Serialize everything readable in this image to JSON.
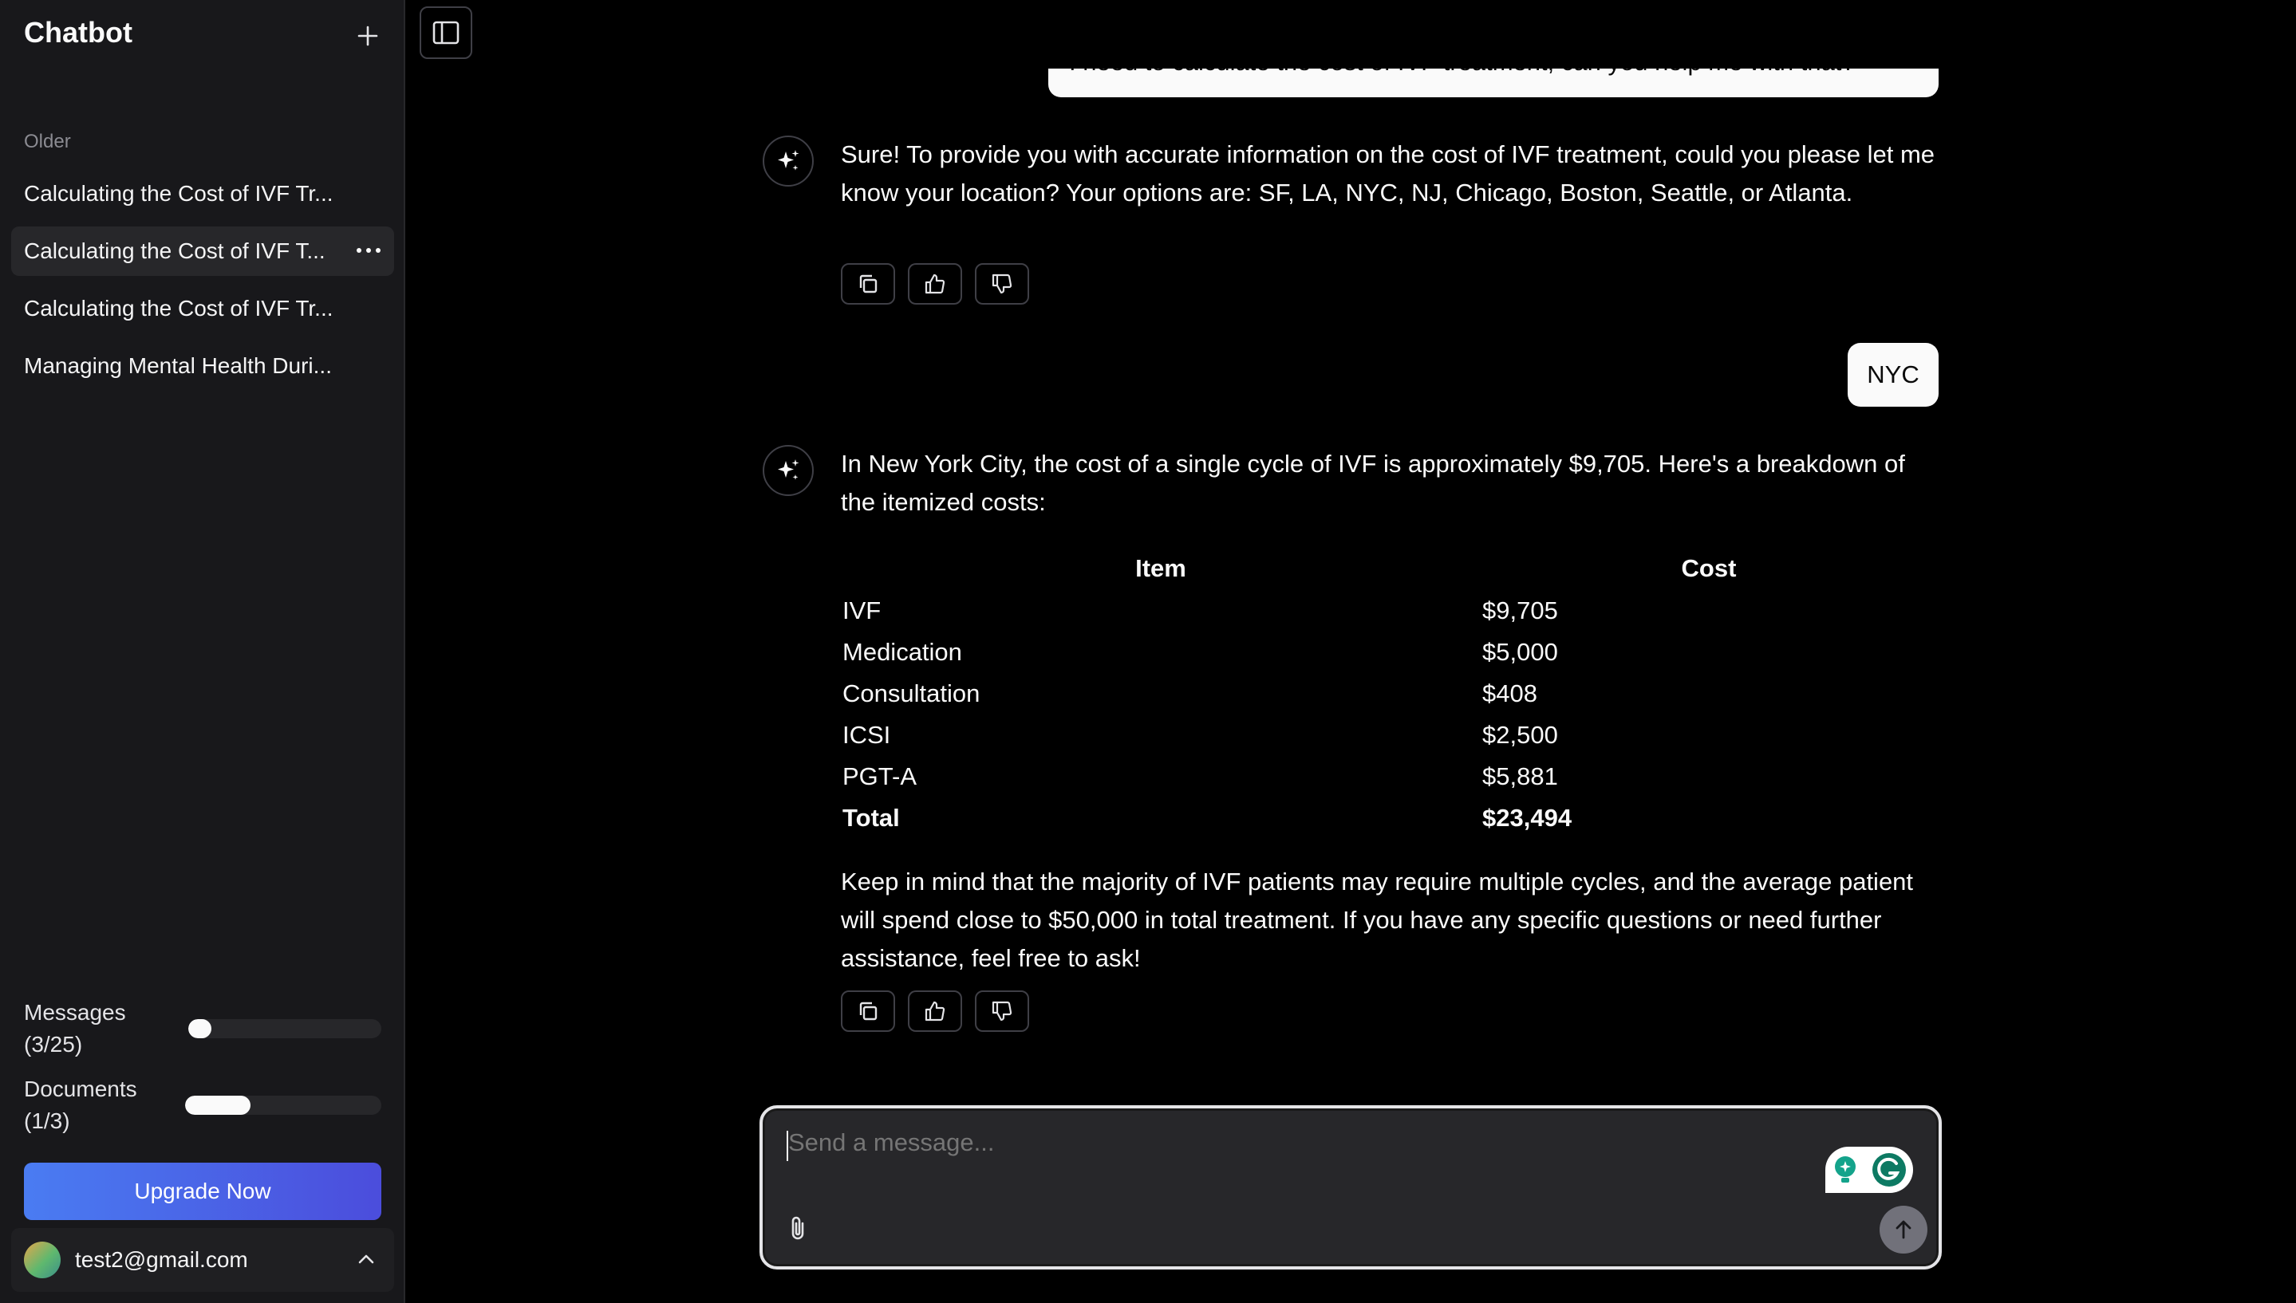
{
  "sidebar": {
    "title": "Chatbot",
    "section_label": "Older",
    "chats": [
      {
        "label": "Calculating the Cost of IVF Tr..."
      },
      {
        "label": "Calculating the Cost of IVF T..."
      },
      {
        "label": "Calculating the Cost of IVF Tr..."
      },
      {
        "label": "Managing Mental Health Duri..."
      }
    ],
    "messages_label": "Messages",
    "messages_count": "(3/25)",
    "messages_progress": 0.12,
    "documents_label": "Documents",
    "documents_count": "(1/3)",
    "documents_progress": 0.333,
    "upgrade_label": "Upgrade Now",
    "user_email": "test2@gmail.com"
  },
  "conversation": {
    "first_user_message": "I need to calculate the cost of IVF treatment, can you help me with that?",
    "bot_reply_1": "Sure! To provide you with accurate information on the cost of IVF treatment, could you please let me know your location? Your options are: SF, LA, NYC, NJ, Chicago, Boston, Seattle, or Atlanta.",
    "user_reply": "NYC",
    "bot_reply_2_intro": "In New York City, the cost of a single cycle of IVF is approximately $9,705. Here's a breakdown of the itemized costs:",
    "table": {
      "headers": [
        "Item",
        "Cost"
      ],
      "rows": [
        [
          "IVF",
          "$9,705"
        ],
        [
          "Medication",
          "$5,000"
        ],
        [
          "Consultation",
          "$408"
        ],
        [
          "ICSI",
          "$2,500"
        ],
        [
          "PGT-A",
          "$5,881"
        ]
      ],
      "total": [
        "Total",
        "$23,494"
      ]
    },
    "bot_reply_2_outro": "Keep in mind that the majority of IVF patients may require multiple cycles, and the average patient will spend close to $50,000 in total treatment. If you have any specific questions or need further assistance, feel free to ask!"
  },
  "composer": {
    "placeholder": "Send a message..."
  },
  "colors": {
    "background": "#000000",
    "sidebar": "#18181b",
    "accent_gradient_start": "#4a7cf2",
    "accent_gradient_end": "#4b4ddc"
  }
}
